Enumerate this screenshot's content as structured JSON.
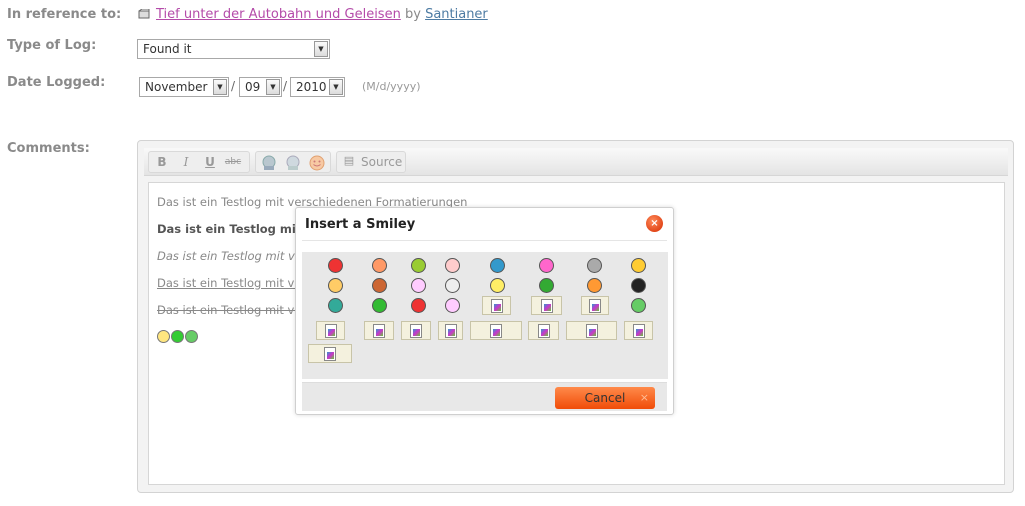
{
  "form": {
    "reference_label": "In reference to:",
    "cache_name": "Tief unter der Autobahn und Geleisen",
    "by_text": "by",
    "owner": "Santianer",
    "type_label": "Type of Log:",
    "type_value": "Found it",
    "date_label": "Date Logged:",
    "month": "November",
    "day": "09",
    "year": "2010",
    "date_sep": "/",
    "date_hint": "(M/d/yyyy)",
    "comments_label": "Comments:"
  },
  "toolbar": {
    "bold": "B",
    "italic": "I",
    "underline": "U",
    "strike": "abc",
    "source": "Source"
  },
  "editor": {
    "lines": [
      "Das ist ein Testlog mit verschiedenen Formatierungen",
      "Das ist ein Testlog mit verschiedenen Formatierungen",
      "Das ist ein Testlog mit verschiedenen Formatierungen",
      "Das ist ein Testlog mit verschiedenen Formatierungen",
      "Das ist ein Testlog mit verschiedenen Formatierungen"
    ],
    "smileys_inserted": 3
  },
  "dialog": {
    "title": "Insert a Smiley",
    "cancel": "Cancel",
    "close_glyph": "×",
    "smiley_count": 27,
    "placeholder_count": 13
  },
  "colors": {
    "accent": "#f0540e",
    "link": "#b44ba9",
    "owner_link": "#4d7ba3"
  }
}
